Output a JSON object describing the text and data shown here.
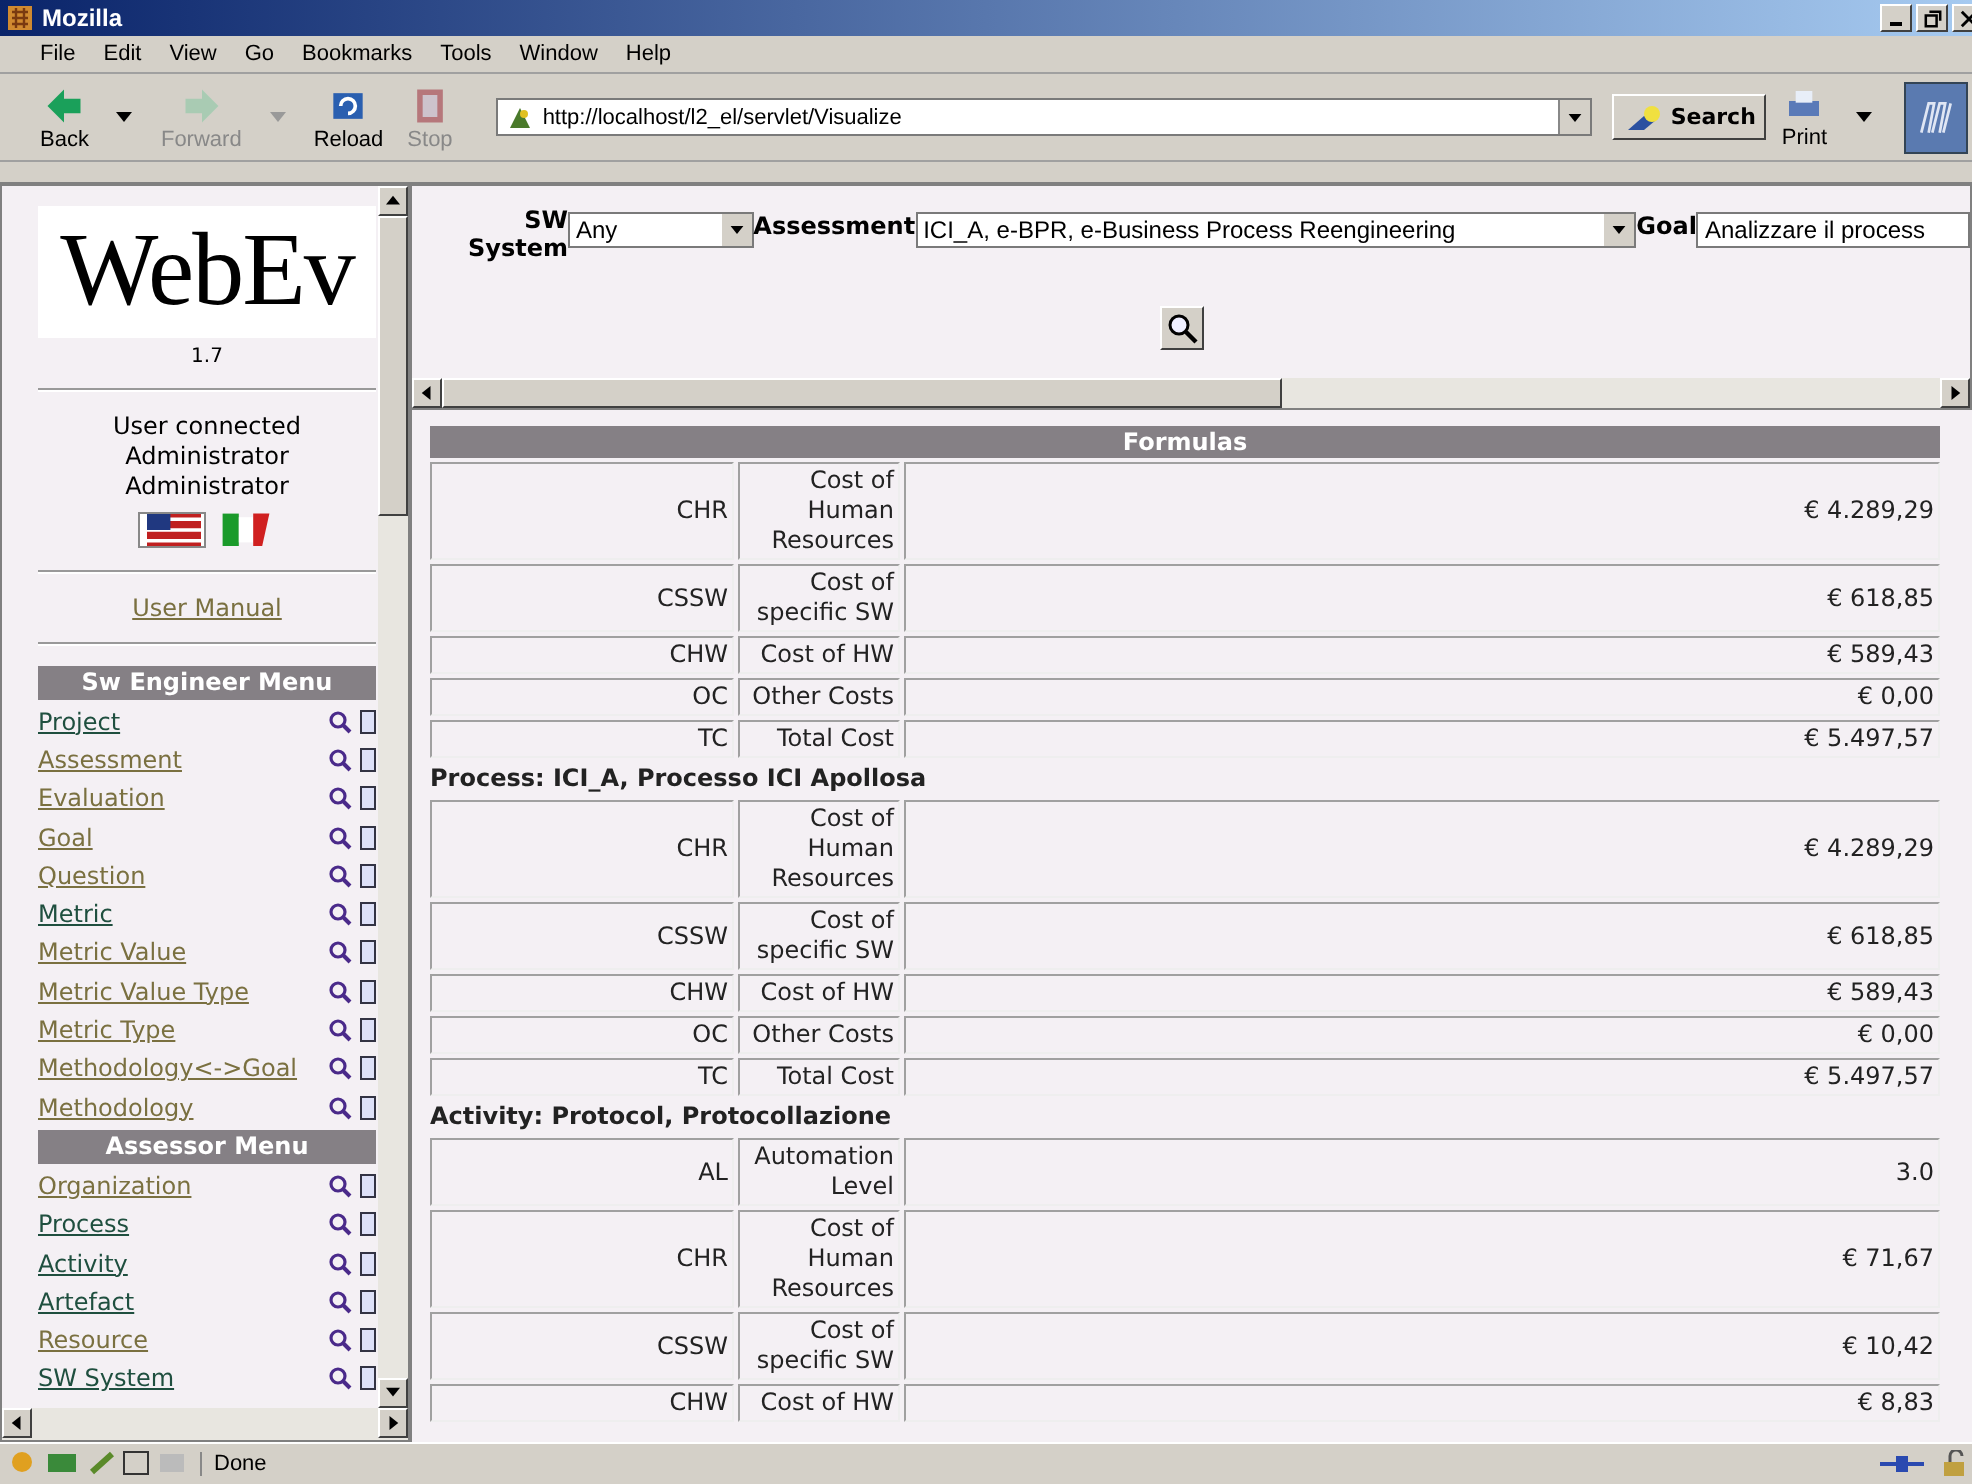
{
  "window": {
    "title": "Mozilla"
  },
  "menu": [
    "File",
    "Edit",
    "View",
    "Go",
    "Bookmarks",
    "Tools",
    "Window",
    "Help"
  ],
  "toolbar": [
    {
      "label": "Back",
      "kind": "back",
      "disabled": false
    },
    {
      "label": "Forward",
      "kind": "forward",
      "disabled": true
    },
    {
      "label": "Reload",
      "kind": "reload",
      "disabled": false
    },
    {
      "label": "Stop",
      "kind": "stop",
      "disabled": true
    }
  ],
  "address": {
    "value": "http://localhost/l2_el/servlet/Visualize"
  },
  "search_button": "Search",
  "print_button": "Print",
  "sidebar": {
    "logo": "WebEv",
    "version": "1.7",
    "user_lines": [
      "User connected",
      "Administrator",
      "Administrator"
    ],
    "languages": [
      {
        "kind": "us",
        "selected": true
      },
      {
        "kind": "it",
        "selected": false
      }
    ],
    "manual_link": "User Manual",
    "menus": [
      {
        "title": "Sw Engineer Menu",
        "items": [
          {
            "label": "Project",
            "visited": false
          },
          {
            "label": "Assessment",
            "visited": true
          },
          {
            "label": "Evaluation",
            "visited": true
          },
          {
            "label": "Goal",
            "visited": true
          },
          {
            "label": "Question",
            "visited": true
          },
          {
            "label": "Metric",
            "visited": false
          },
          {
            "label": "Metric Value",
            "visited": true
          },
          {
            "label": "Metric Value Type",
            "visited": true
          },
          {
            "label": "Metric Type",
            "visited": true
          },
          {
            "label": "Methodology<->Goal",
            "visited": true
          },
          {
            "label": "Methodology",
            "visited": true
          }
        ]
      },
      {
        "title": "Assessor Menu",
        "items": [
          {
            "label": "Organization",
            "visited": true
          },
          {
            "label": "Process",
            "visited": false
          },
          {
            "label": "Activity",
            "visited": false
          },
          {
            "label": "Artefact",
            "visited": false
          },
          {
            "label": "Resource",
            "visited": true
          },
          {
            "label": "SW System",
            "visited": false
          }
        ]
      }
    ]
  },
  "filters": {
    "sw_system_label": [
      "SW",
      "System"
    ],
    "sw_system_value": "Any",
    "assessment_label": "Assessment",
    "assessment_value": "ICI_A, e-BPR, e-Business Process Reengineering",
    "goal_label": "Goal",
    "goal_value": "Analizzare il process"
  },
  "table": {
    "title": "Formulas",
    "sections": [
      {
        "rows": [
          {
            "code": "CHR",
            "name": [
              "Cost of",
              "Human",
              "Resources"
            ],
            "value": "€ 4.289,29"
          },
          {
            "code": "CSSW",
            "name": [
              "Cost of",
              "specific SW"
            ],
            "value": "€ 618,85"
          },
          {
            "code": "CHW",
            "name": [
              "Cost of HW"
            ],
            "value": "€ 589,43"
          },
          {
            "code": "OC",
            "name": [
              "Other Costs"
            ],
            "value": "€ 0,00"
          },
          {
            "code": "TC",
            "name": [
              "Total Cost"
            ],
            "value": "€ 5.497,57"
          }
        ]
      },
      {
        "heading": "Process: ICI_A, Processo ICI Apollosa",
        "rows": [
          {
            "code": "CHR",
            "name": [
              "Cost of",
              "Human",
              "Resources"
            ],
            "value": "€ 4.289,29"
          },
          {
            "code": "CSSW",
            "name": [
              "Cost of",
              "specific SW"
            ],
            "value": "€ 618,85"
          },
          {
            "code": "CHW",
            "name": [
              "Cost of HW"
            ],
            "value": "€ 589,43"
          },
          {
            "code": "OC",
            "name": [
              "Other Costs"
            ],
            "value": "€ 0,00"
          },
          {
            "code": "TC",
            "name": [
              "Total Cost"
            ],
            "value": "€ 5.497,57"
          }
        ]
      },
      {
        "heading": "Activity: Protocol, Protocollazione",
        "rows": [
          {
            "code": "AL",
            "name": [
              "Automation",
              "Level"
            ],
            "value": "3.0"
          },
          {
            "code": "CHR",
            "name": [
              "Cost of",
              "Human",
              "Resources"
            ],
            "value": "€ 71,67"
          },
          {
            "code": "CSSW",
            "name": [
              "Cost of",
              "specific SW"
            ],
            "value": "€ 10,42"
          },
          {
            "code": "CHW",
            "name": [
              "Cost of HW"
            ],
            "value": "€ 8,83"
          }
        ]
      }
    ]
  },
  "status_bar": {
    "text": "Done"
  }
}
